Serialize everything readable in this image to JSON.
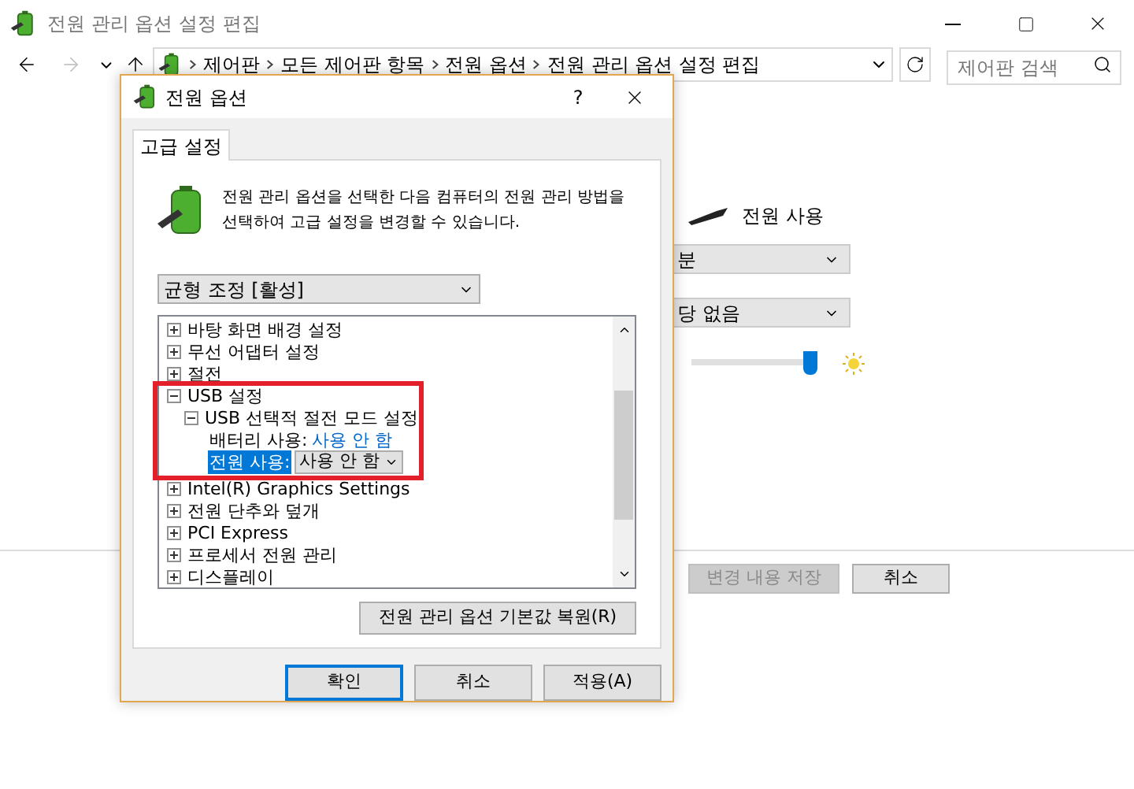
{
  "window": {
    "title": "전원 관리 옵션 설정 편집"
  },
  "address_bar": {
    "breadcrumbs": [
      "제어판",
      "모든 제어판 항목",
      "전원 옵션",
      "전원 관리 옵션 설정 편집"
    ]
  },
  "search": {
    "placeholder": "제어판 검색"
  },
  "background": {
    "column_heading": "전원 사용",
    "dropdowns": [
      "분",
      "당 없음"
    ],
    "slider": {
      "level": 0.97
    },
    "buttons": [
      {
        "label": "변경 내용 저장",
        "disabled": true
      },
      {
        "label": "취소",
        "disabled": false
      }
    ]
  },
  "dialog": {
    "title": "전원 옵션",
    "help": "?",
    "tabs": [
      {
        "label": "고급 설정",
        "selected": true
      }
    ],
    "description": "전원 관리 옵션을 선택한 다음 컴퓨터의 전원 관리 방법을 선택하여 고급 설정을 변경할 수 있습니다.",
    "plan_dropdown": "균형 조정 [활성]",
    "tree": [
      {
        "kind": "group",
        "label": "바탕 화면 배경 설정",
        "expanded": false
      },
      {
        "kind": "group",
        "label": "무선 어댑터 설정",
        "expanded": false
      },
      {
        "kind": "group",
        "label": "절전",
        "expanded": false
      },
      {
        "kind": "group",
        "label": "USB 설정",
        "expanded": true,
        "children": [
          {
            "kind": "group",
            "label": "USB 선택적 절전 모드 설정",
            "expanded": true,
            "children": [
              {
                "kind": "setting",
                "label": "배터리 사용:",
                "value": "사용 안 함",
                "selected": false
              },
              {
                "kind": "setting",
                "label": "전원 사용:",
                "value": "사용 안 함",
                "selected": true
              }
            ]
          }
        ]
      },
      {
        "kind": "group",
        "label": "Intel(R) Graphics Settings",
        "expanded": false
      },
      {
        "kind": "group",
        "label": "전원 단추와 덮개",
        "expanded": false
      },
      {
        "kind": "group",
        "label": "PCI Express",
        "expanded": false
      },
      {
        "kind": "group",
        "label": "프로세서 전원 관리",
        "expanded": false
      },
      {
        "kind": "group",
        "label": "디스플레이",
        "expanded": false
      }
    ],
    "restore_button": "전원 관리 옵션 기본값 복원(R)",
    "buttons": [
      {
        "label": "확인",
        "default": true
      },
      {
        "label": "취소",
        "default": false
      },
      {
        "label": "적용(A)",
        "default": false
      }
    ]
  }
}
